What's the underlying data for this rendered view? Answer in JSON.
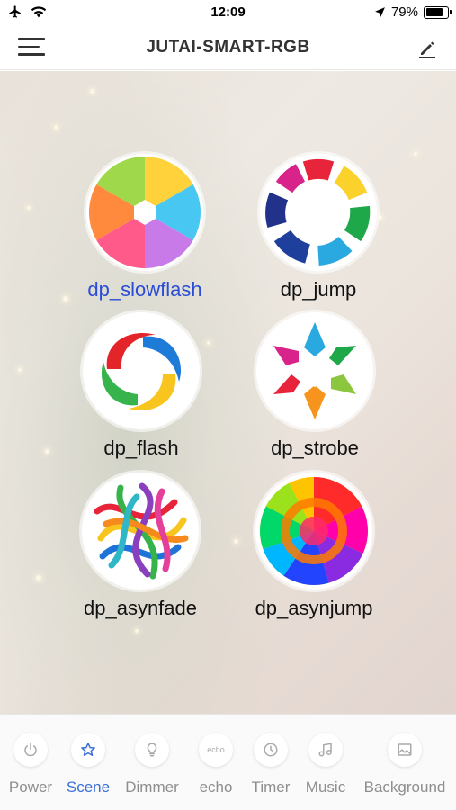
{
  "status_bar": {
    "time": "12:09",
    "battery": "79%"
  },
  "nav": {
    "title": "JUTAI-SMART-RGB"
  },
  "scenes": [
    {
      "label": "dp_slowflash",
      "icon": "slowflash-icon",
      "active": true
    },
    {
      "label": "dp_jump",
      "icon": "jump-icon",
      "active": false
    },
    {
      "label": "dp_flash",
      "icon": "flash-icon",
      "active": false
    },
    {
      "label": "dp_strobe",
      "icon": "strobe-icon",
      "active": false
    },
    {
      "label": "dp_asynfade",
      "icon": "asynfade-icon",
      "active": false
    },
    {
      "label": "dp_asynjump",
      "icon": "asynjump-icon",
      "active": false
    }
  ],
  "tabs": [
    {
      "label": "Power",
      "icon": "power-icon",
      "active": false
    },
    {
      "label": "Scene",
      "icon": "star-icon",
      "active": true
    },
    {
      "label": "Dimmer",
      "icon": "bulb-icon",
      "active": false
    },
    {
      "label": "echo",
      "icon": "echo-icon",
      "icon_text": "echo",
      "active": false
    },
    {
      "label": "Timer",
      "icon": "clock-icon",
      "active": false
    },
    {
      "label": "Music",
      "icon": "music-icon",
      "active": false
    },
    {
      "label": "Background",
      "icon": "image-icon",
      "active": false
    }
  ],
  "colors": {
    "active_scene": "#2b4dd6",
    "active_tab": "#3a6fd8",
    "inactive_tab": "#8e8e8e"
  }
}
